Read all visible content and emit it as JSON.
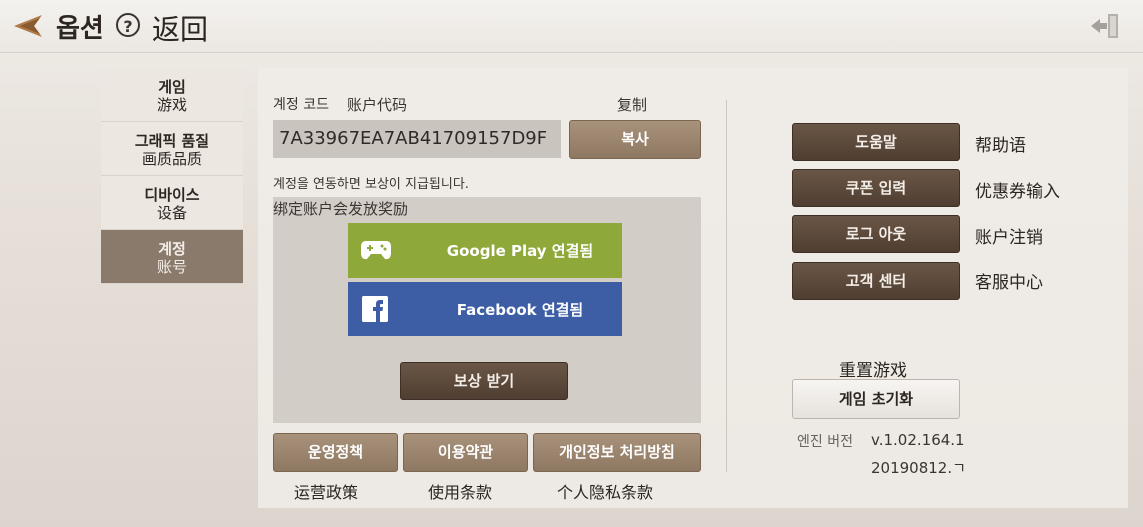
{
  "header": {
    "title": "옵션",
    "help_symbol": "?",
    "back_label": "返回"
  },
  "tabs": [
    {
      "ko": "게임",
      "cn": "游戏"
    },
    {
      "ko": "그래픽 품질",
      "cn": "画质品质"
    },
    {
      "ko": "디바이스",
      "cn": "设备"
    },
    {
      "ko": "계정",
      "cn": "账号"
    }
  ],
  "account": {
    "code_label_ko": "계정 코드",
    "code_label_cn": "账户代码",
    "copy_label_cn": "复制",
    "code_value": "7A33967EA7AB41709157D9F",
    "copy_button": "복사",
    "reward_notice_ko": "계정을 연동하면 보상이 지급됩니다.",
    "reward_notice_cn": "绑定账户会发放奖励",
    "google_play_button": "Google Play 연결됨",
    "facebook_button": "Facebook 연결됨",
    "claim_reward_button": "보상 받기"
  },
  "policies": [
    {
      "ko": "운영정책",
      "cn": "运营政策"
    },
    {
      "ko": "이용약관",
      "cn": "使用条款"
    },
    {
      "ko": "개인정보 처리방침",
      "cn": "个人隐私条款"
    }
  ],
  "right_menu": [
    {
      "ko": "도움말",
      "cn": "帮助语"
    },
    {
      "ko": "쿠폰 입력",
      "cn": "优惠券输入"
    },
    {
      "ko": "로그 아웃",
      "cn": "账户注销"
    },
    {
      "ko": "고객 센터",
      "cn": "客服中心"
    }
  ],
  "reset": {
    "title_cn": "重置游戏",
    "button": "게임 초기화",
    "engine_label": "엔진 버전",
    "version": "v.1.02.164.1",
    "build": "20190812.ㄱ"
  },
  "colors": {
    "active_tab": "#8a7a6c",
    "google_green": "#8ea83a",
    "facebook_blue": "#3d5ea5",
    "dark_button": "#5a4839"
  }
}
